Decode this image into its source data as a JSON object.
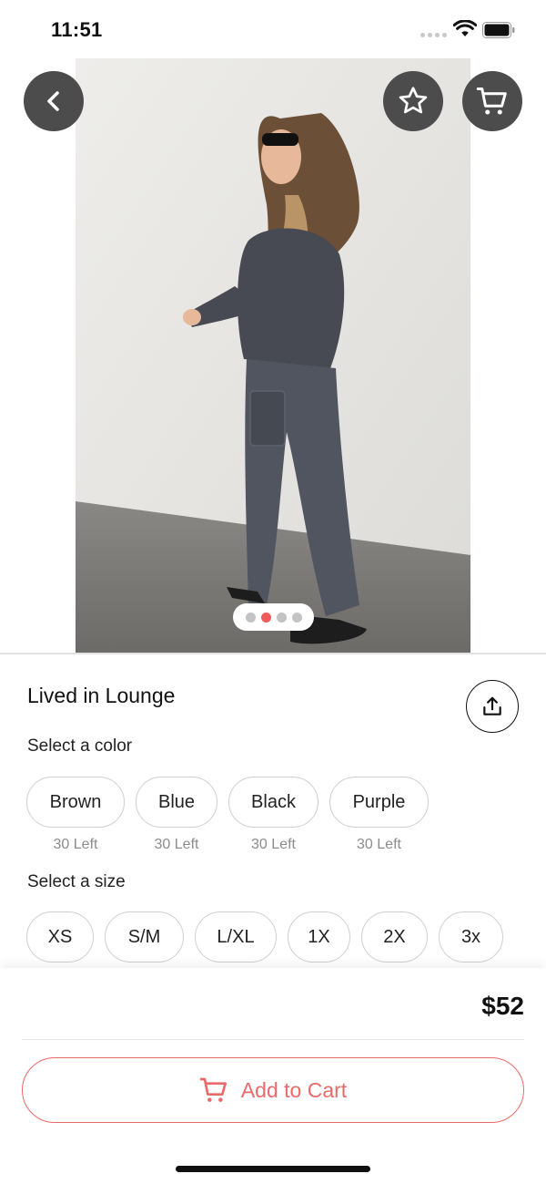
{
  "status_bar": {
    "time": "11:51"
  },
  "product": {
    "title": "Lived in Lounge",
    "price": "$52",
    "image_page_count": 4,
    "image_active_page": 2
  },
  "color_section": {
    "label": "Select a color",
    "options": [
      {
        "name": "Brown",
        "stock": "30 Left"
      },
      {
        "name": "Blue",
        "stock": "30 Left"
      },
      {
        "name": "Black",
        "stock": "30 Left"
      },
      {
        "name": "Purple",
        "stock": "30 Left"
      }
    ]
  },
  "size_section": {
    "label": "Select a size",
    "options": [
      "XS",
      "S/M",
      "L/XL",
      "1X",
      "2X",
      "3x"
    ]
  },
  "actions": {
    "add_to_cart": "Add to Cart"
  },
  "icons": {
    "back": "chevron-left-icon",
    "favorite": "star-icon",
    "cart": "cart-icon",
    "share": "share-icon"
  },
  "colors": {
    "accent": "#ea6a6a",
    "active_dot": "#ef5b5b",
    "overlay_button": "#4c4c4c"
  }
}
